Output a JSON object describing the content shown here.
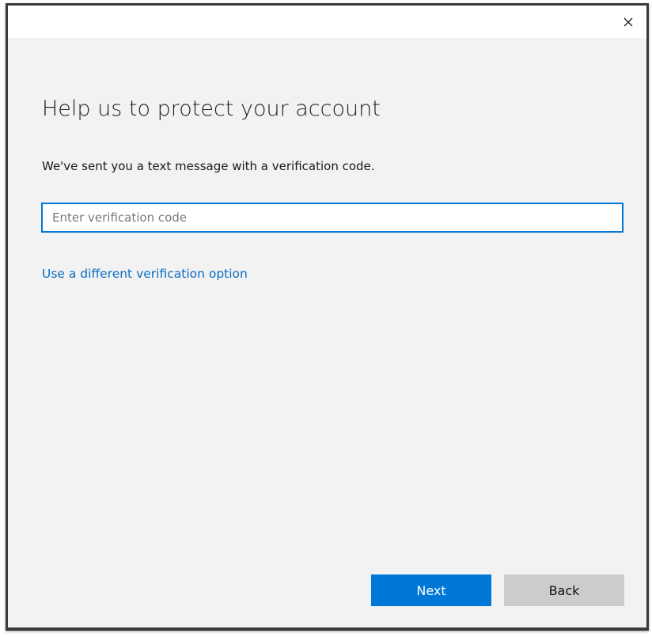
{
  "window": {
    "close_label": "×"
  },
  "content": {
    "heading": "Help us to protect your account",
    "message": "We've sent you a text message with a verification code.",
    "code_input": {
      "value": "",
      "placeholder": "Enter verification code"
    },
    "alt_option_link": "Use a different verification option"
  },
  "buttons": {
    "next_label": "Next",
    "back_label": "Back"
  },
  "colors": {
    "accent": "#0078d7",
    "link": "#0a6cc2",
    "secondary_button": "#cccccc",
    "background": "#f2f2f2"
  },
  "icons": {
    "close": "close-icon"
  }
}
